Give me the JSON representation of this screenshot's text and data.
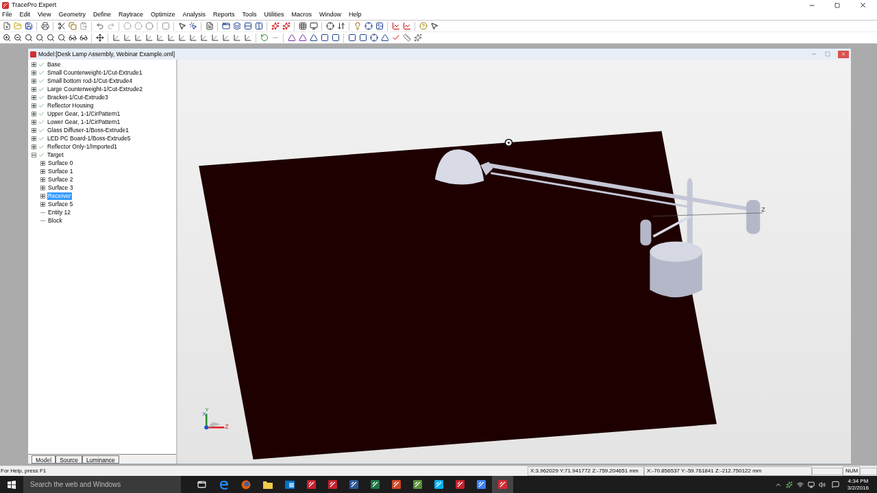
{
  "app": {
    "title": "TracePro Expert"
  },
  "menu": [
    "File",
    "Edit",
    "View",
    "Geometry",
    "Define",
    "Raytrace",
    "Optimize",
    "Analysis",
    "Reports",
    "Tools",
    "Utilities",
    "Macros",
    "Window",
    "Help"
  ],
  "document": {
    "title": "Model:[Desk Lamp Assembly, Webinar Example.oml]"
  },
  "tree": [
    {
      "label": "Base",
      "checked": true,
      "kind": "branch",
      "expanded": false,
      "selected": false
    },
    {
      "label": "Small Counterweight-1/Cut-Extrude1",
      "checked": true,
      "kind": "branch",
      "expanded": false,
      "selected": false
    },
    {
      "label": "Small bottom rod-1/Cut-Extrude4",
      "checked": true,
      "kind": "branch",
      "expanded": false,
      "selected": false
    },
    {
      "label": "Large Counterweight-1/Cut-Extrude2",
      "checked": true,
      "kind": "branch",
      "expanded": false,
      "selected": false
    },
    {
      "label": "Bracket-1/Cut-Extrude3",
      "checked": true,
      "kind": "branch",
      "expanded": false,
      "selected": false
    },
    {
      "label": "Reflector Housing",
      "checked": true,
      "kind": "branch",
      "expanded": false,
      "selected": false
    },
    {
      "label": "Upper Gear, 1-1/CirPattern1",
      "checked": true,
      "kind": "branch",
      "expanded": false,
      "selected": false
    },
    {
      "label": "Lower Gear, 1-1/CirPattern1",
      "checked": true,
      "kind": "branch",
      "expanded": false,
      "selected": false
    },
    {
      "label": "Glass Diffuser-1/Boss-Extrude1",
      "checked": true,
      "kind": "branch",
      "expanded": false,
      "selected": false
    },
    {
      "label": "LED PC Board-1/Boss-Extrude5",
      "checked": true,
      "kind": "branch",
      "expanded": false,
      "selected": false
    },
    {
      "label": "Reflector Only-1/Imported1",
      "checked": true,
      "kind": "branch",
      "expanded": false,
      "selected": false
    },
    {
      "label": "Target",
      "checked": true,
      "kind": "branch",
      "expanded": true,
      "selected": false,
      "children": [
        {
          "label": "Surface 0",
          "checked": false,
          "kind": "branch",
          "expanded": false,
          "selected": false
        },
        {
          "label": "Surface 1",
          "checked": false,
          "kind": "branch",
          "expanded": false,
          "selected": false
        },
        {
          "label": "Surface 2",
          "checked": false,
          "kind": "branch",
          "expanded": false,
          "selected": false
        },
        {
          "label": "Surface 3",
          "checked": false,
          "kind": "branch",
          "expanded": false,
          "selected": false
        },
        {
          "label": "Receiver",
          "checked": false,
          "kind": "branch",
          "expanded": false,
          "selected": true
        },
        {
          "label": "Surface 5",
          "checked": false,
          "kind": "branch",
          "expanded": false,
          "selected": false
        },
        {
          "label": "Entity 12",
          "checked": false,
          "kind": "leaf",
          "selected": false
        },
        {
          "label": "Block",
          "checked": false,
          "kind": "leaf",
          "selected": false
        }
      ]
    }
  ],
  "tabs": [
    {
      "label": "Model",
      "selected": true
    },
    {
      "label": "Source",
      "selected": false
    },
    {
      "label": "Luminance",
      "selected": false
    }
  ],
  "viewport": {
    "lamp_axis_label": "Z",
    "triad": {
      "x": "X",
      "y": "Y",
      "z": "Z"
    }
  },
  "status_bar": {
    "help": "For Help, press F1",
    "coords_1": "X:3.962029 Y:71.941772 Z:-759.204651 mm",
    "coords_2": "X:-70.856537 Y:-59.761841 Z:-212.750122 mm",
    "indicator": "NUM"
  },
  "taskbar": {
    "search_placeholder": "Search the web and Windows",
    "time": "4:34 PM",
    "date": "3/2/2016"
  }
}
